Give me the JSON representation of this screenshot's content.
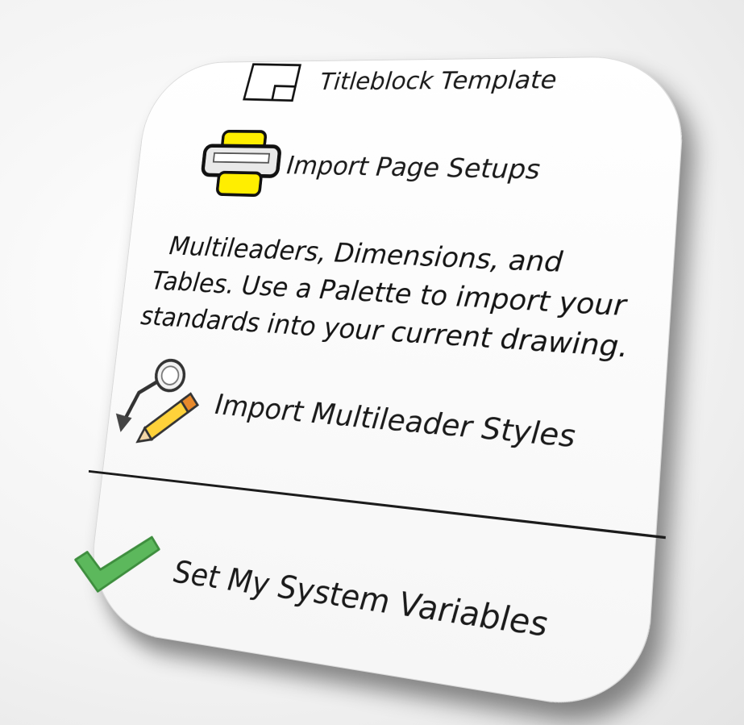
{
  "menu": {
    "items": [
      {
        "id": "titleblock",
        "label": "Titleblock Template",
        "icon": "titleblock-icon"
      },
      {
        "id": "pagesetup",
        "label": "Import Page Setups",
        "icon": "printer-icon"
      },
      {
        "id": "mleader",
        "label": "Import Multileader Styles",
        "icon": "multileader-pencil-icon"
      },
      {
        "id": "sysvars",
        "label": "Set My System Variables",
        "icon": "checkmark-icon"
      }
    ],
    "description": {
      "line1": "Multileaders, Dimensions, and",
      "line2": "Tables. Use a Palette to import your",
      "line3": "standards into your current drawing."
    }
  },
  "colors": {
    "printer_yellow": "#ffee00",
    "checkmark_green": "#5cb85c",
    "pencil_orange": "#e8892b"
  }
}
